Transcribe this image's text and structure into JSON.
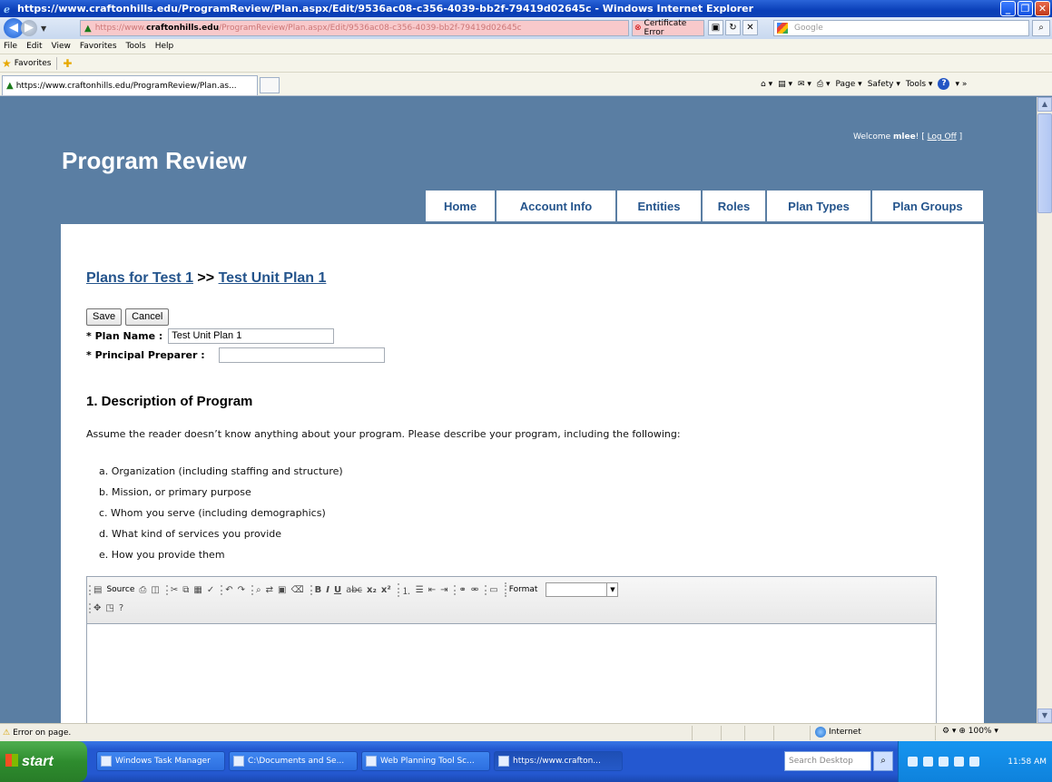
{
  "window": {
    "title": "https://www.craftonhills.edu/ProgramReview/Plan.aspx/Edit/9536ac08-c356-4039-bb2f-79419d02645c - Windows Internet Explorer"
  },
  "address": {
    "prefix": "https://www.",
    "host": "craftonhills.edu",
    "rest": "/ProgramReview/Plan.aspx/Edit/9536ac08-c356-4039-bb2f-79419d02645c",
    "cert_error": "Certificate Error",
    "search_placeholder": "Google"
  },
  "menu": [
    "File",
    "Edit",
    "View",
    "Favorites",
    "Tools",
    "Help"
  ],
  "favorites": {
    "label": "Favorites"
  },
  "tab": {
    "title": "https://www.craftonhills.edu/ProgramReview/Plan.as..."
  },
  "commands": {
    "page": "Page",
    "safety": "Safety",
    "tools": "Tools"
  },
  "site": {
    "welcome_prefix": "Welcome",
    "user": "mlee",
    "logoff": "Log Off",
    "title": "Program Review",
    "nav": [
      "Home",
      "Account Info",
      "Entities",
      "Roles",
      "Plan Types",
      "Plan Groups"
    ]
  },
  "page": {
    "crumb_link1": "Plans for Test 1",
    "crumb_sep": ">>",
    "crumb_link2": "Test Unit Plan 1",
    "save": "Save",
    "cancel": "Cancel",
    "plan_name_label": "* Plan Name :",
    "plan_name_value": "Test Unit Plan 1",
    "preparer_label": "* Principal Preparer :",
    "preparer_value": "",
    "section_title": "1. Description of Program",
    "intro": "Assume the reader doesn’t know anything about your program. Please describe your program, including the following:",
    "items": [
      "a. Organization (including staffing and structure)",
      "b. Mission, or primary purpose",
      "c. Whom you serve (including demographics)",
      "d. What kind of services you provide",
      "e. How you provide them"
    ],
    "editor": {
      "source": "Source",
      "format": "Format"
    }
  },
  "status": {
    "message": "Error on page.",
    "zone": "Internet",
    "zoom": "100%"
  },
  "taskbar": {
    "start": "start",
    "tasks": [
      "Windows Task Manager",
      "C:\\Documents and Se...",
      "Web Planning Tool Sc...",
      "https://www.crafton..."
    ],
    "search_placeholder": "Search Desktop",
    "clock": "11:58 AM"
  }
}
